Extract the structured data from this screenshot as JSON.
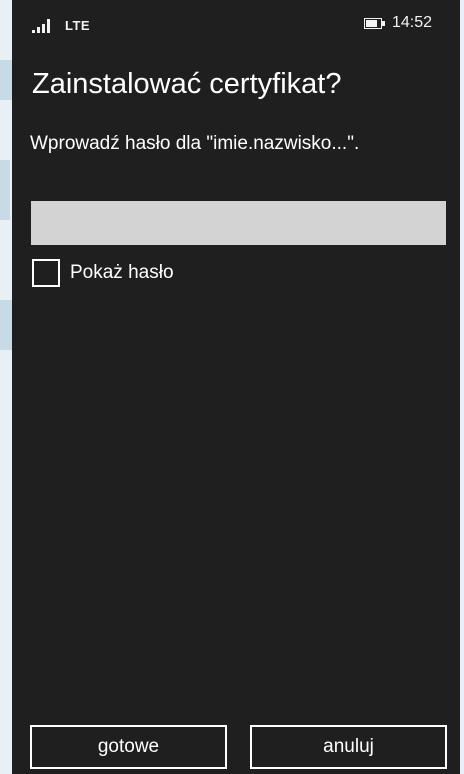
{
  "status_bar": {
    "network": "LTE",
    "battery_level": 0.8,
    "time": "14:52"
  },
  "dialog": {
    "title": "Zainstalować certyfikat?",
    "prompt": "Wprowadź hasło dla \"imie.nazwisko...\".",
    "password_value": "",
    "show_password_label": "Pokaż hasło",
    "show_password_checked": false
  },
  "buttons": {
    "done_label": "gotowe",
    "cancel_label": "anuluj"
  },
  "colors": {
    "background": "#1f1f1f",
    "input_fill": "#d3d3d3",
    "text": "#ffffff"
  }
}
